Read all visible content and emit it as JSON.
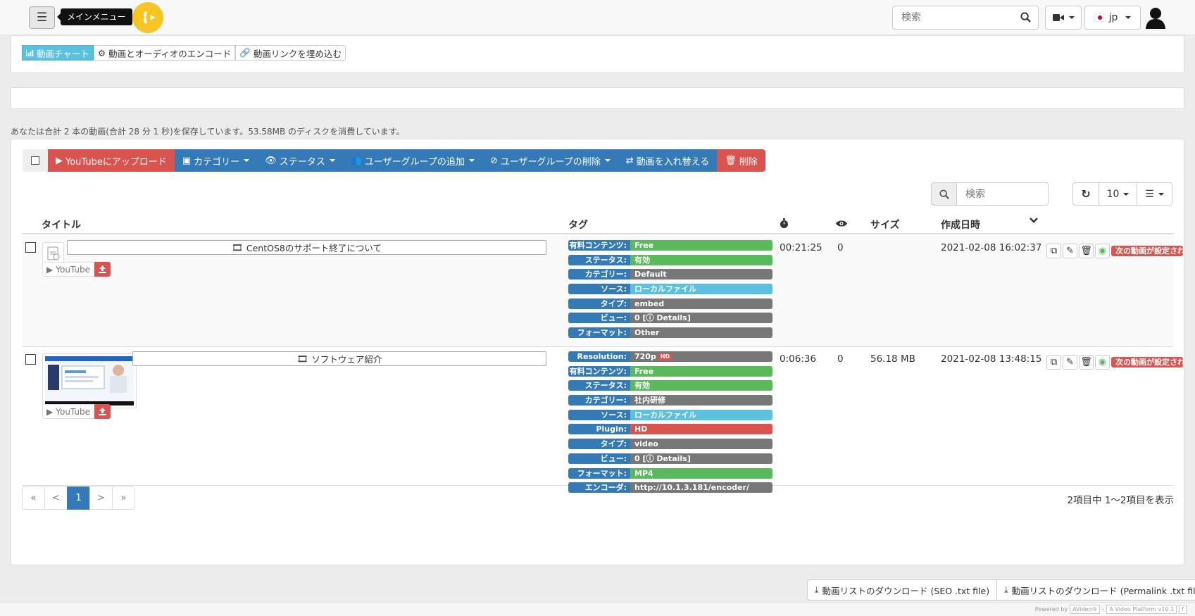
{
  "navbar": {
    "menu_tooltip": "メインメニュー",
    "logo_text": "AVIDEO",
    "search_placeholder": "検索",
    "lang": "jp"
  },
  "top_buttons": {
    "chart": "動画チャート",
    "encode": "動画とオーディオのエンコード",
    "embed": "動画リンクを埋め込む"
  },
  "summary": "あなたは合計 2 本の動画(合計 28 分 1 秒)を保存しています。53.58MB のディスクを消費しています。",
  "bulk": {
    "youtube": "YouTubeにアップロード",
    "category": "カテゴリー",
    "status": "ステータス",
    "add_group": "ユーザーグループの追加",
    "remove_group": "ユーザーグループの削除",
    "swap": "動画を入れ替える",
    "delete": "削除"
  },
  "grid": {
    "search_placeholder": "検索",
    "rows_per_page": "10"
  },
  "columns": {
    "title": "タイトル",
    "tags": "タグ",
    "size": "サイズ",
    "created": "作成日時"
  },
  "rows": [
    {
      "title": "CentOS8のサポート終了について",
      "youtube": "YouTube",
      "duration": "00:21:25",
      "views": "0",
      "size": "",
      "created": "2021-02-08 16:02:37",
      "next": "次の動画が設定されていません",
      "tags": [
        {
          "k": "有料コンテンツ:",
          "v": "Free",
          "color": "#5cb85c"
        },
        {
          "k": "ステータス:",
          "v": "有効",
          "color": "#5cb85c"
        },
        {
          "k": "カテゴリー:",
          "v": "Default",
          "color": "#777777"
        },
        {
          "k": "ソース:",
          "v": "ローカルファイル",
          "color": "#5bc0de"
        },
        {
          "k": "タイプ:",
          "v": "embed",
          "color": "#777777"
        },
        {
          "k": "ビュー:",
          "v": "0 [ⓘ Details]",
          "color": "#777777"
        },
        {
          "k": "フォーマット:",
          "v": "Other",
          "color": "#777777"
        }
      ]
    },
    {
      "title": "ソフトウェア紹介",
      "youtube": "YouTube",
      "duration": "0:06:36",
      "views": "0",
      "size": "56.18 MB",
      "created": "2021-02-08 13:48:15",
      "next": "次の動画が設定されていません",
      "tags": [
        {
          "k": "Resolution:",
          "v": "720p",
          "color": "#777777",
          "badge": "HD"
        },
        {
          "k": "有料コンテンツ:",
          "v": "Free",
          "color": "#5cb85c"
        },
        {
          "k": "ステータス:",
          "v": "有効",
          "color": "#5cb85c"
        },
        {
          "k": "カテゴリー:",
          "v": "社内研修",
          "color": "#777777"
        },
        {
          "k": "ソース:",
          "v": "ローカルファイル",
          "color": "#5bc0de"
        },
        {
          "k": "Plugin:",
          "v": "HD",
          "color": "#d9534f"
        },
        {
          "k": "タイプ:",
          "v": "video",
          "color": "#777777"
        },
        {
          "k": "ビュー:",
          "v": "0 [ⓘ Details]",
          "color": "#777777"
        },
        {
          "k": "フォーマット:",
          "v": "MP4",
          "color": "#5cb85c"
        },
        {
          "k": "エンコーダ:",
          "v": "http://10.1.3.181/encoder/",
          "color": "#777777"
        }
      ]
    }
  ],
  "pagination": {
    "first": "«",
    "prev": "<",
    "current": "1",
    "next": ">",
    "last": "»",
    "info": "2項目中 1〜2項目を表示"
  },
  "downloads": {
    "seo": "動画リストのダウンロード (SEO .txt file)",
    "permalink": "動画リストのダウンロード (Permalink .txt file)"
  },
  "footer": {
    "powered": "Powered by",
    "brand": "AVideo®",
    "platform": "A Video Platform v10.1"
  }
}
